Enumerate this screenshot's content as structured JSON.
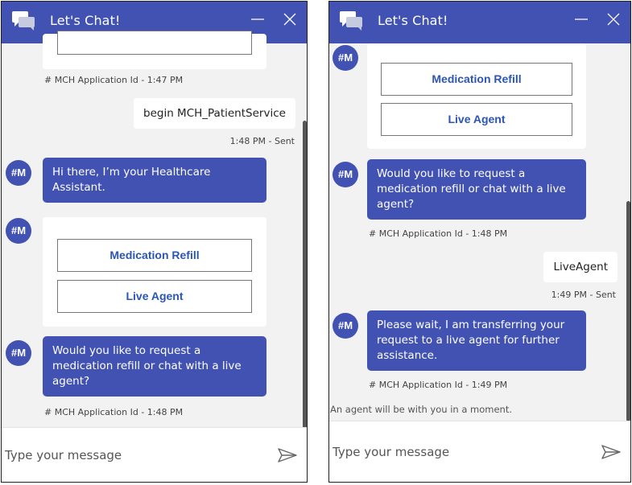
{
  "header": {
    "title": "Let's Chat!"
  },
  "colors": {
    "brand": "#4152b3",
    "button_text": "#2b55b8",
    "background": "#f2f2f2"
  },
  "icons": {
    "chat": "chat-bubbles-icon",
    "minimize": "minimize-icon",
    "close": "close-icon",
    "send": "send-icon"
  },
  "left": {
    "partial_meta": "# MCH Application Id - 1:47 PM",
    "user_message": {
      "text": "begin MCH_PatientService",
      "meta": "1:48 PM - Sent"
    },
    "bot_greeting": {
      "avatar": "#M",
      "text": "Hi there, I’m your Healthcare Assistant."
    },
    "options_card": {
      "avatar": "#M",
      "buttons": [
        "Medication Refill",
        "Live Agent"
      ]
    },
    "bot_question": {
      "avatar": "#M",
      "text": "Would you like to request a medication refill or chat with a live agent?",
      "meta": "# MCH Application Id - 1:48 PM"
    },
    "input": {
      "placeholder": "Type your message"
    }
  },
  "right": {
    "options_card": {
      "avatar": "#M",
      "buttons": [
        "Medication Refill",
        "Live Agent"
      ]
    },
    "bot_question": {
      "avatar": "#M",
      "text": "Would you like to request a medication refill or chat with a live agent?",
      "meta": "# MCH Application Id - 1:48 PM"
    },
    "user_message": {
      "text": "LiveAgent",
      "meta": "1:49 PM - Sent"
    },
    "bot_transfer": {
      "avatar": "#M",
      "text": "Please wait, I am transferring your request to a live agent for further assistance.",
      "meta": "# MCH Application Id - 1:49 PM"
    },
    "notice": "An agent will be with you in a moment.",
    "input": {
      "placeholder": "Type your message"
    }
  }
}
